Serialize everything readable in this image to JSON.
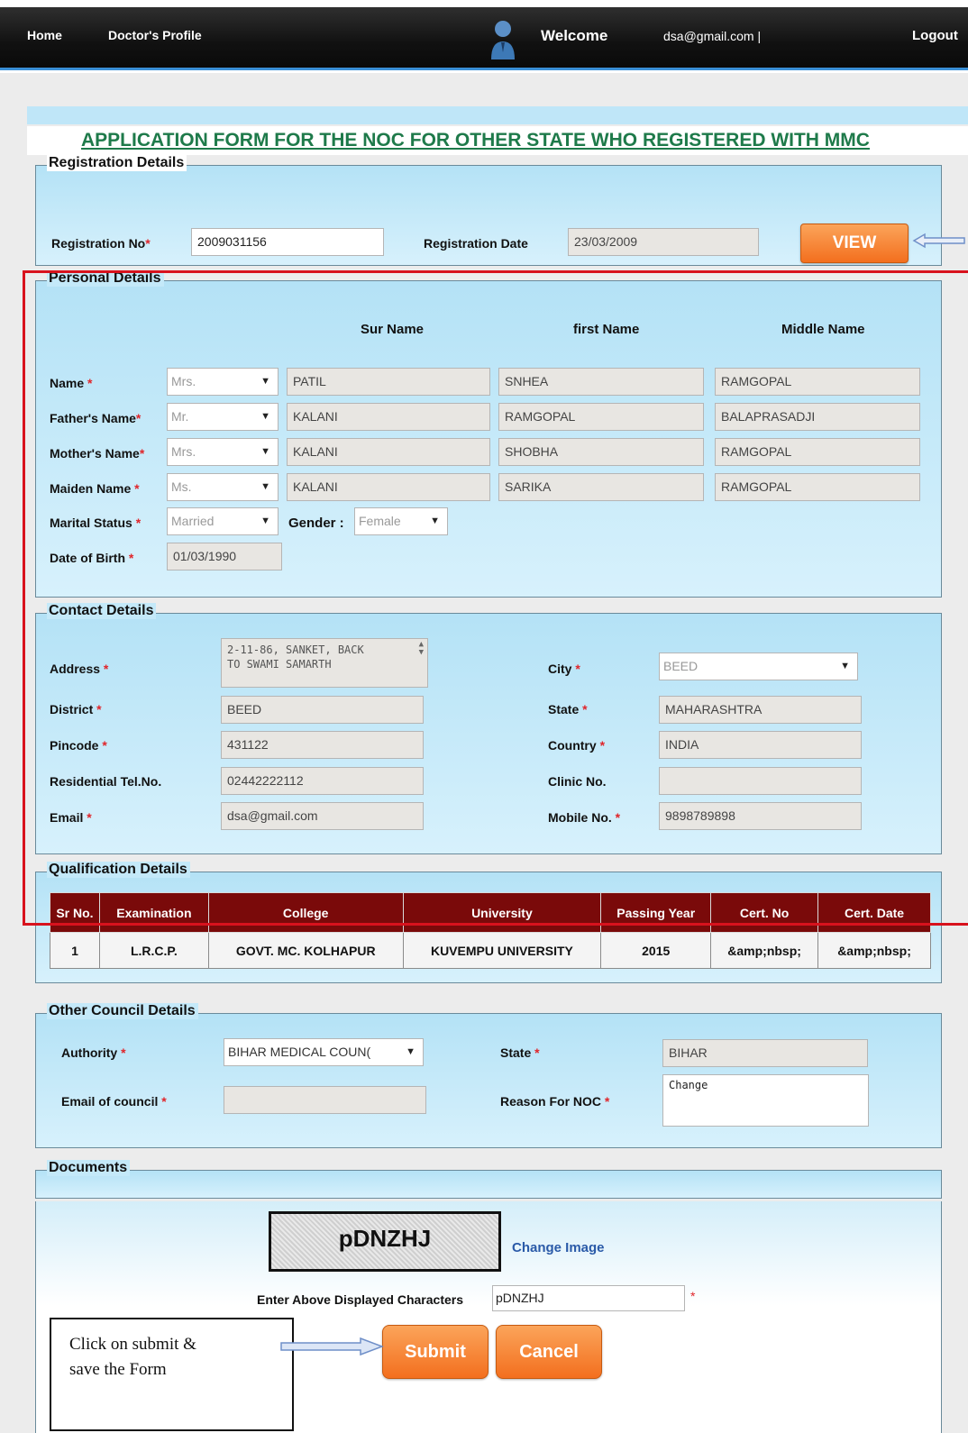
{
  "nav": {
    "home": "Home",
    "profile": "Doctor's Profile",
    "welcome": "Welcome",
    "email": "dsa@gmail.com |",
    "logout": "Logout"
  },
  "form_title": "APPLICATION FORM FOR THE NOC FOR OTHER STATE WHO REGISTERED WITH MMC",
  "registration": {
    "legend": "Registration Details",
    "reg_no_label": "Registration No",
    "reg_no_value": "2009031156",
    "reg_date_label": "Registration Date",
    "reg_date_value": "23/03/2009",
    "view_button": "VIEW"
  },
  "personal": {
    "legend": "Personal Details",
    "col_sur": "Sur Name",
    "col_first": "first Name",
    "col_middle": "Middle Name",
    "rows": [
      {
        "label": "Name ",
        "title": "Mrs.",
        "sur": "PATIL",
        "first": "SNHEA",
        "middle": "RAMGOPAL"
      },
      {
        "label": "Father's Name",
        "title": "Mr.",
        "sur": "KALANI",
        "first": "RAMGOPAL",
        "middle": "BALAPRASADJI"
      },
      {
        "label": "Mother's Name",
        "title": "Mrs.",
        "sur": "KALANI",
        "first": "SHOBHA",
        "middle": "RAMGOPAL"
      },
      {
        "label": "Maiden Name ",
        "title": "Ms.",
        "sur": "KALANI",
        "first": "SARIKA",
        "middle": "RAMGOPAL"
      }
    ],
    "marital_label": "Marital Status ",
    "marital_value": "Married",
    "gender_label": "Gender :",
    "gender_value": "Female",
    "dob_label": "Date of Birth ",
    "dob_value": "01/03/1990"
  },
  "contact": {
    "legend": "Contact Details",
    "address_label": "Address ",
    "address_line1": "2-11-86, SANKET, BACK",
    "address_line2": "TO SWAMI SAMARTH",
    "city_label": "City ",
    "city_value": "BEED",
    "district_label": "District ",
    "district_value": "BEED",
    "state_label": "State ",
    "state_value": "MAHARASHTRA",
    "pincode_label": "Pincode ",
    "pincode_value": "431122",
    "country_label": "Country ",
    "country_value": "INDIA",
    "res_tel_label": "Residential Tel.No.",
    "res_tel_value": "02442222112",
    "clinic_label": "Clinic No.",
    "clinic_value": "",
    "email_label": "Email ",
    "email_value": "dsa@gmail.com",
    "mobile_label": "Mobile No. ",
    "mobile_value": "9898789898"
  },
  "qualification": {
    "legend": "Qualification Details",
    "headers": [
      "Sr No.",
      "Examination",
      "College",
      "University",
      "Passing Year",
      "Cert. No",
      "Cert. Date"
    ],
    "rows": [
      [
        "1",
        "L.R.C.P.",
        "GOVT. MC. KOLHAPUR",
        "KUVEMPU UNIVERSITY",
        "2015",
        "&amp;nbsp;",
        "&amp;nbsp;"
      ]
    ]
  },
  "council": {
    "legend": "Other Council Details",
    "authority_label": "Authority ",
    "authority_value": "BIHAR MEDICAL COUN(",
    "state_label": "State ",
    "state_value": "BIHAR",
    "email_label": "Email of council ",
    "email_value": "",
    "reason_label": "Reason For NOC ",
    "reason_value": "Change"
  },
  "documents": {
    "legend": "Documents"
  },
  "captcha": {
    "image_text": "pDNZHJ",
    "change_image": "Change Image",
    "enter_label": "Enter Above Displayed Characters",
    "enter_value": "pDNZHJ"
  },
  "actions": {
    "submit": "Submit",
    "cancel": "Cancel"
  },
  "callout": {
    "line1": "Click on submit &",
    "line2": "save the Form"
  },
  "required_mark": "*",
  "colors": {
    "nav_bg": "#111111",
    "title_color": "#1e7a4a",
    "panel_bg": "#c4e9f9",
    "button_orange": "#f36f1e",
    "table_header": "#7a0a0a",
    "highlight_red": "#d8121d"
  },
  "icons": {
    "user_avatar": "user-avatar-icon",
    "dropdown": "chevron-down-icon",
    "arrow": "arrow-right-icon"
  }
}
